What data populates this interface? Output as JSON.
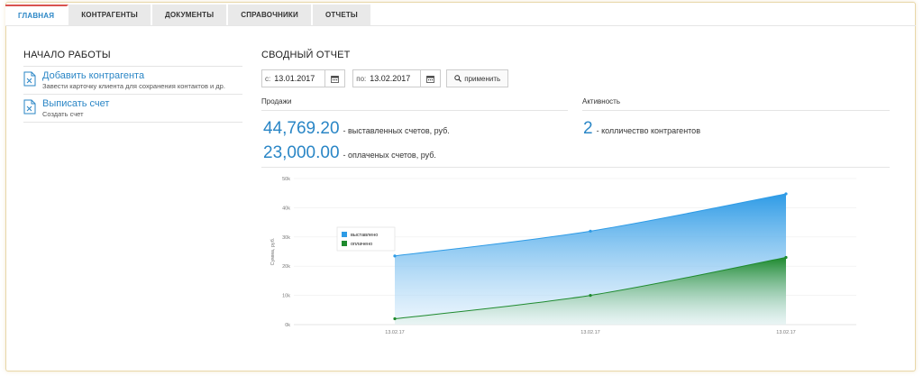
{
  "tabs": [
    {
      "label": "ГЛАВНАЯ",
      "active": true
    },
    {
      "label": "КОНТРАГЕНТЫ",
      "active": false
    },
    {
      "label": "ДОКУМЕНТЫ",
      "active": false
    },
    {
      "label": "СПРАВОЧНИКИ",
      "active": false
    },
    {
      "label": "ОТЧЕТЫ",
      "active": false
    }
  ],
  "start": {
    "title": "НАЧАЛО РАБОТЫ",
    "items": [
      {
        "link": "Добавить контрагента",
        "desc": "Завести карточку клиента для сохранения контактов и др.",
        "icon": "document-icon"
      },
      {
        "link": "Выписать счет",
        "desc": "Создать счет",
        "icon": "document-icon"
      }
    ]
  },
  "report": {
    "title": "СВОДНЫЙ ОТЧЕТ",
    "from_prefix": "с:",
    "from_value": "13.01.2017",
    "to_prefix": "по:",
    "to_value": "13.02.2017",
    "apply_label": "применить",
    "sales_heading": "Продажи",
    "activity_heading": "Активность",
    "issued_amount": "44,769.20",
    "issued_label": "- выставленных счетов, руб.",
    "paid_amount": "23,000.00",
    "paid_label": "- оплаченых счетов, руб.",
    "contractors_count": "2",
    "contractors_label": "- колличество контрагентов"
  },
  "colors": {
    "accent": "#2a86c6",
    "issued": "#2e9be6",
    "paid": "#1e8a2e",
    "active_tab_border": "#d9534f"
  },
  "chart_data": {
    "type": "area",
    "x": [
      "13.02.17",
      "13.02.17",
      "13.02.17"
    ],
    "ylabel": "Сумма, руб.",
    "ylim": [
      0,
      50000
    ],
    "yticks": [
      "0k",
      "10k",
      "20k",
      "30k",
      "40k",
      "50k"
    ],
    "grid": true,
    "legend_position": "top-left",
    "series": [
      {
        "name": "выставлено",
        "values": [
          23500,
          32000,
          44769.2
        ],
        "color": "#2e9be6"
      },
      {
        "name": "оплачено",
        "values": [
          2000,
          10000,
          23000
        ],
        "color": "#1e8a2e"
      }
    ]
  }
}
